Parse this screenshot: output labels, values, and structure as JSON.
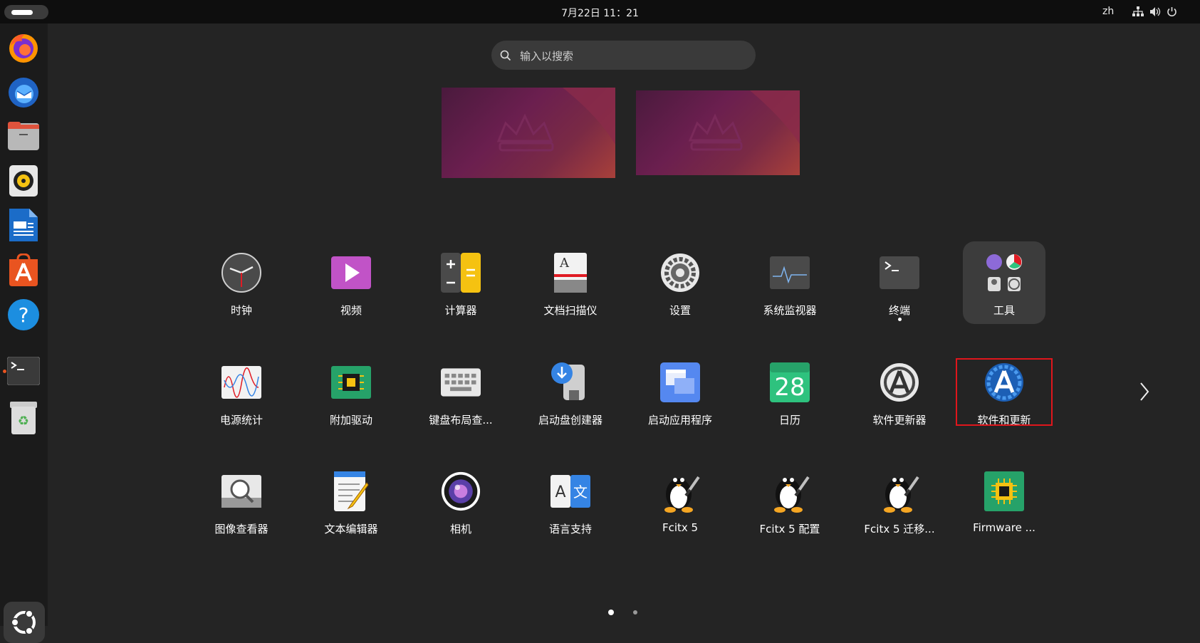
{
  "topbar": {
    "clock": "7月22日  11：21",
    "language": "zh"
  },
  "search": {
    "placeholder": "输入以搜索"
  },
  "dock": {
    "items": [
      "firefox",
      "thunderbird",
      "files",
      "rhythmbox",
      "libreoffice-writer",
      "app-center",
      "help",
      "terminal",
      "trash"
    ]
  },
  "apps": {
    "row1": [
      "时钟",
      "视频",
      "计算器",
      "文档扫描仪",
      "设置",
      "系统监视器",
      "终端",
      "工具"
    ],
    "row2": [
      "电源统计",
      "附加驱动",
      "键盘布局查...",
      "启动盘创建器",
      "启动应用程序",
      "日历",
      "软件更新器",
      "软件和更新"
    ],
    "row3": [
      "图像查看器",
      "文本编辑器",
      "相机",
      "语言支持",
      "Fcitx 5",
      "Fcitx 5 配置",
      "Fcitx 5 迁移...",
      "Firmware ..."
    ]
  },
  "calendar_icon_day": "28",
  "pager": {
    "pages": 2,
    "current": 1
  },
  "colors": {
    "highlight": "#e0161c",
    "accent": "#e95420"
  }
}
